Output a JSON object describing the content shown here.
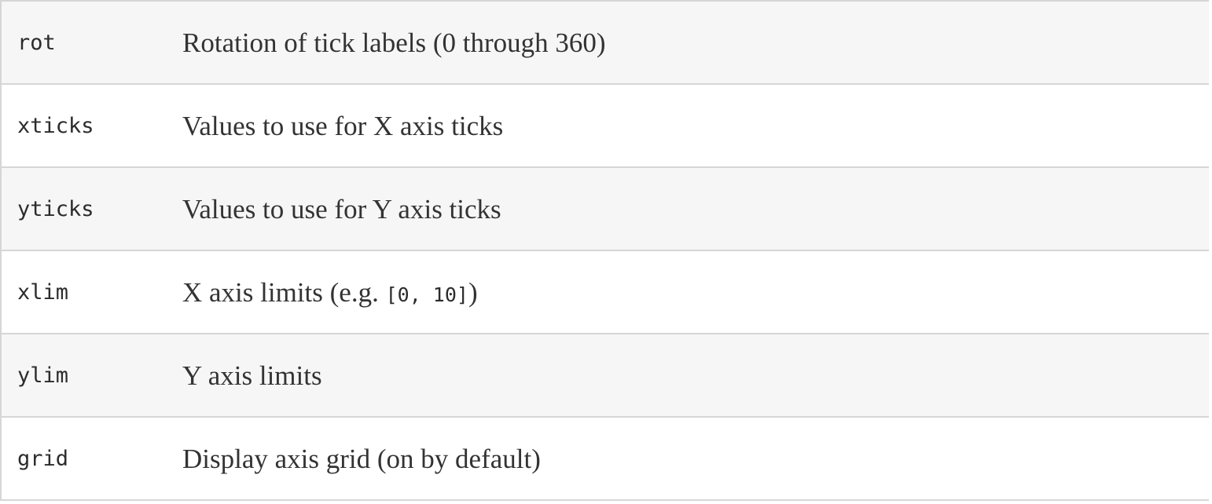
{
  "rows": [
    {
      "key": "rot",
      "desc": "Rotation of tick labels (0 through 360)"
    },
    {
      "key": "xticks",
      "desc": "Values to use for X axis ticks"
    },
    {
      "key": "yticks",
      "desc": "Values to use for Y axis ticks"
    },
    {
      "key": "xlim",
      "desc_prefix": "X axis limits (e.g. ",
      "desc_code": "[0, 10]",
      "desc_suffix": ")"
    },
    {
      "key": "ylim",
      "desc": "Y axis limits"
    },
    {
      "key": "grid",
      "desc": "Display axis grid (on by default)"
    }
  ]
}
